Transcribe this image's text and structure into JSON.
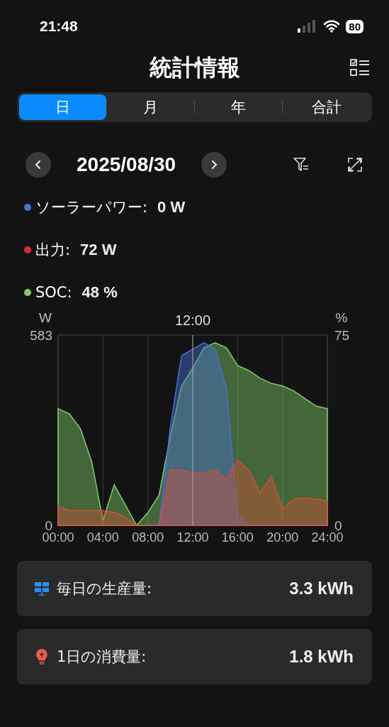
{
  "status_bar": {
    "time": "21:48",
    "battery": "80"
  },
  "header": {
    "title": "統計情報"
  },
  "tabs": [
    {
      "label": "日",
      "selected": true
    },
    {
      "label": "月",
      "selected": false
    },
    {
      "label": "年",
      "selected": false
    },
    {
      "label": "合計",
      "selected": false
    }
  ],
  "date_nav": {
    "date": "2025/08/30"
  },
  "legend": [
    {
      "label": "ソーラーパワー:",
      "value": "0 W",
      "color": "#4a6fd6"
    },
    {
      "label": "出力:",
      "value": "72 W",
      "color": "#d0303a"
    },
    {
      "label": "SOC:",
      "value": "48 %",
      "color": "#7fcf6a"
    }
  ],
  "chart": {
    "chart_data": {
      "type": "area",
      "ylabel": "W",
      "y2label": "%",
      "x": [
        0,
        1,
        2,
        3,
        4,
        5,
        6,
        7,
        8,
        9,
        10,
        11,
        12,
        13,
        14,
        15,
        16,
        17,
        18,
        19,
        20,
        21,
        22,
        23,
        24
      ],
      "xlim": [
        0,
        24
      ],
      "ylim": [
        0,
        583
      ],
      "y2lim": [
        0,
        75
      ],
      "xticks": [
        {
          "value": 0,
          "label": "00:00"
        },
        {
          "value": 4,
          "label": "04:00"
        },
        {
          "value": 8,
          "label": "08:00"
        },
        {
          "value": 12,
          "label": "12:00"
        },
        {
          "value": 16,
          "label": "16:00"
        },
        {
          "value": 20,
          "label": "20:00"
        },
        {
          "value": 24,
          "label": "24:00"
        }
      ],
      "yticks": [
        0,
        583
      ],
      "y2ticks": [
        0,
        75
      ],
      "grid": true,
      "stacked": false,
      "series": [
        {
          "color": "#7fcf6a",
          "axis": "y2",
          "values": [
            46,
            44,
            38,
            25,
            2,
            16,
            8,
            0,
            5,
            12,
            35,
            55,
            62,
            70,
            72,
            70,
            63,
            61,
            58,
            56,
            55,
            53,
            50,
            47,
            46
          ]
        },
        {
          "color": "#4a6fd6",
          "values": [
            null,
            null,
            null,
            null,
            null,
            null,
            null,
            null,
            0,
            0,
            300,
            520,
            540,
            560,
            540,
            420,
            30,
            0,
            0,
            0,
            0,
            0,
            0,
            0,
            0
          ]
        },
        {
          "color": "#d0503a",
          "values": [
            60,
            45,
            45,
            45,
            45,
            40,
            25,
            0,
            0,
            0,
            170,
            170,
            160,
            160,
            170,
            140,
            200,
            170,
            100,
            150,
            50,
            80,
            85,
            80,
            75
          ]
        }
      ],
      "annotations": [
        {
          "x": 12,
          "text": "12:00"
        }
      ]
    }
  },
  "cards": [
    {
      "kind": "production",
      "label": "毎日の生産量:",
      "value": "3.3 kWh"
    },
    {
      "kind": "consumption",
      "label": "1日の消費量:",
      "value": "1.8 kWh"
    }
  ]
}
